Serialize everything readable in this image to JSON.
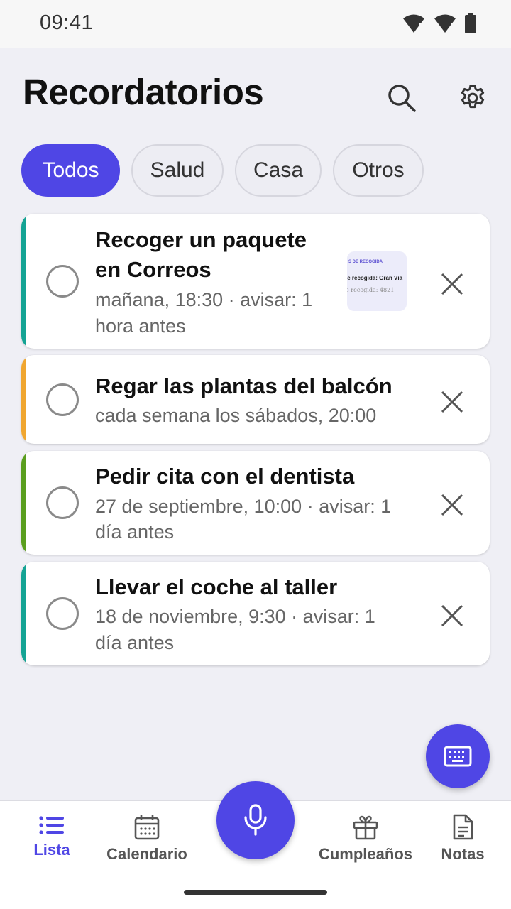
{
  "status": {
    "time": "09:41"
  },
  "header": {
    "title": "Recordatorios",
    "search_icon": "search-icon",
    "settings_icon": "gear-icon"
  },
  "filters": [
    {
      "label": "Todos",
      "selected": true
    },
    {
      "label": "Salud",
      "selected": false
    },
    {
      "label": "Casa",
      "selected": false
    },
    {
      "label": "Otros",
      "selected": false
    }
  ],
  "reminders": [
    {
      "title_line1": "Recoger un paquete",
      "title_line2": "en Correos",
      "sub_line1": "mañana, 18:30 · avisar: 1",
      "sub_line2": "hora antes",
      "color": "#14a394",
      "thumbnail": {
        "line1": "S DE RECOGIDA",
        "line2": "le recogida: Gran Vía",
        "line3": "e recogida: 4821"
      }
    },
    {
      "title_line1": "Regar las plantas del balcón",
      "sub_line1": "cada semana los sábados, 20:00",
      "color": "#f0a630"
    },
    {
      "title_line1": "Pedir cita con el dentista",
      "sub_line1": "27 de septiembre, 10:00 · avisar: 1",
      "sub_line2": "día antes",
      "color": "#5a9e1e"
    },
    {
      "title_line1": "Llevar el coche al taller",
      "sub_line1": "18 de noviembre, 9:30 · avisar: 1",
      "sub_line2": "día antes",
      "color": "#14a394"
    }
  ],
  "nav": {
    "lista": "Lista",
    "calendario": "Calendario",
    "cumpleanos": "Cumpleaños",
    "notas": "Notas"
  },
  "colors": {
    "accent": "#4f46e5",
    "background": "#efeff5"
  }
}
